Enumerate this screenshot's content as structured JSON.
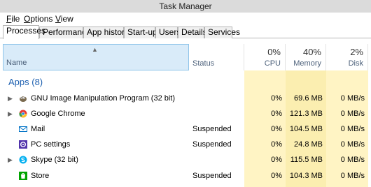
{
  "window": {
    "title": "Task Manager"
  },
  "menu": {
    "file": {
      "underlined": "F",
      "rest": "ile"
    },
    "options": {
      "underlined": "O",
      "rest": "ptions"
    },
    "view": {
      "underlined": "V",
      "rest": "iew"
    }
  },
  "tabs": [
    "Processes",
    "Performance",
    "App history",
    "Start-up",
    "Users",
    "Details",
    "Services"
  ],
  "columns": {
    "name": "Name",
    "status": "Status",
    "cpu": {
      "percent": "0%",
      "label": "CPU"
    },
    "memory": {
      "percent": "40%",
      "label": "Memory"
    },
    "disk": {
      "percent": "2%",
      "label": "Disk"
    }
  },
  "group": {
    "title": "Apps (8)"
  },
  "rows": [
    {
      "name": "GNU Image Manipulation Program (32 bit)",
      "status": "",
      "cpu": "0%",
      "memory": "69.6 MB",
      "disk": "0 MB/s",
      "expandable": true,
      "icon": "gimp-icon"
    },
    {
      "name": "Google Chrome",
      "status": "",
      "cpu": "0%",
      "memory": "121.3 MB",
      "disk": "0 MB/s",
      "expandable": true,
      "icon": "chrome-icon"
    },
    {
      "name": "Mail",
      "status": "Suspended",
      "cpu": "0%",
      "memory": "104.5 MB",
      "disk": "0 MB/s",
      "expandable": false,
      "icon": "mail-icon"
    },
    {
      "name": "PC settings",
      "status": "Suspended",
      "cpu": "0%",
      "memory": "24.8 MB",
      "disk": "0 MB/s",
      "expandable": false,
      "icon": "pc-settings-icon"
    },
    {
      "name": "Skype (32 bit)",
      "status": "",
      "cpu": "0%",
      "memory": "115.5 MB",
      "disk": "0 MB/s",
      "expandable": true,
      "icon": "skype-icon"
    },
    {
      "name": "Store",
      "status": "Suspended",
      "cpu": "0%",
      "memory": "104.3 MB",
      "disk": "0 MB/s",
      "expandable": false,
      "icon": "store-icon"
    }
  ],
  "colors": {
    "cpu_bg": "#fff4c4",
    "memory_bg": "#fbeeb0",
    "disk_bg": "#fff4c4",
    "group_title": "#1c5fb0"
  }
}
